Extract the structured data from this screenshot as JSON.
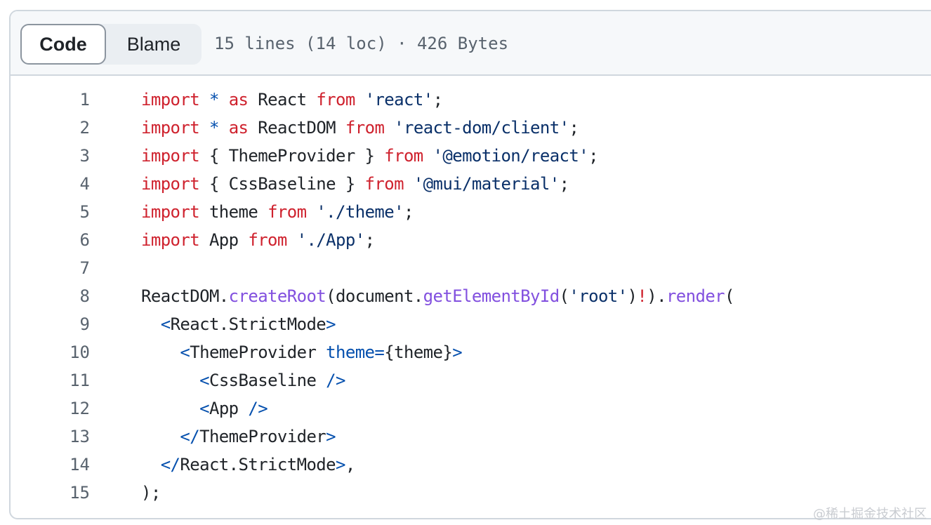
{
  "tabs": [
    {
      "label": "Code",
      "active": true
    },
    {
      "label": "Blame",
      "active": false
    }
  ],
  "file_info": "15 lines (14 loc) · 426 Bytes",
  "code_lines": [
    {
      "number": "1",
      "tokens": [
        {
          "t": "import",
          "k": "kw"
        },
        {
          "t": " ",
          "k": "plain"
        },
        {
          "t": "*",
          "k": "tag"
        },
        {
          "t": " ",
          "k": "plain"
        },
        {
          "t": "as",
          "k": "kw"
        },
        {
          "t": " React ",
          "k": "plain"
        },
        {
          "t": "from",
          "k": "kw"
        },
        {
          "t": " ",
          "k": "plain"
        },
        {
          "t": "'react'",
          "k": "str"
        },
        {
          "t": ";",
          "k": "plain"
        }
      ]
    },
    {
      "number": "2",
      "tokens": [
        {
          "t": "import",
          "k": "kw"
        },
        {
          "t": " ",
          "k": "plain"
        },
        {
          "t": "*",
          "k": "tag"
        },
        {
          "t": " ",
          "k": "plain"
        },
        {
          "t": "as",
          "k": "kw"
        },
        {
          "t": " ReactDOM ",
          "k": "plain"
        },
        {
          "t": "from",
          "k": "kw"
        },
        {
          "t": " ",
          "k": "plain"
        },
        {
          "t": "'react-dom/client'",
          "k": "str"
        },
        {
          "t": ";",
          "k": "plain"
        }
      ]
    },
    {
      "number": "3",
      "tokens": [
        {
          "t": "import",
          "k": "kw"
        },
        {
          "t": " { ThemeProvider } ",
          "k": "plain"
        },
        {
          "t": "from",
          "k": "kw"
        },
        {
          "t": " ",
          "k": "plain"
        },
        {
          "t": "'@emotion/react'",
          "k": "str"
        },
        {
          "t": ";",
          "k": "plain"
        }
      ]
    },
    {
      "number": "4",
      "tokens": [
        {
          "t": "import",
          "k": "kw"
        },
        {
          "t": " { CssBaseline } ",
          "k": "plain"
        },
        {
          "t": "from",
          "k": "kw"
        },
        {
          "t": " ",
          "k": "plain"
        },
        {
          "t": "'@mui/material'",
          "k": "str"
        },
        {
          "t": ";",
          "k": "plain"
        }
      ]
    },
    {
      "number": "5",
      "tokens": [
        {
          "t": "import",
          "k": "kw"
        },
        {
          "t": " theme ",
          "k": "plain"
        },
        {
          "t": "from",
          "k": "kw"
        },
        {
          "t": " ",
          "k": "plain"
        },
        {
          "t": "'./theme'",
          "k": "str"
        },
        {
          "t": ";",
          "k": "plain"
        }
      ]
    },
    {
      "number": "6",
      "tokens": [
        {
          "t": "import",
          "k": "kw"
        },
        {
          "t": " App ",
          "k": "plain"
        },
        {
          "t": "from",
          "k": "kw"
        },
        {
          "t": " ",
          "k": "plain"
        },
        {
          "t": "'./App'",
          "k": "str"
        },
        {
          "t": ";",
          "k": "plain"
        }
      ]
    },
    {
      "number": "7",
      "tokens": []
    },
    {
      "number": "8",
      "tokens": [
        {
          "t": "ReactDOM.",
          "k": "plain"
        },
        {
          "t": "createRoot",
          "k": "fn"
        },
        {
          "t": "(document.",
          "k": "plain"
        },
        {
          "t": "getElementById",
          "k": "fn"
        },
        {
          "t": "(",
          "k": "plain"
        },
        {
          "t": "'root'",
          "k": "str"
        },
        {
          "t": ")",
          "k": "plain"
        },
        {
          "t": "!",
          "k": "kw"
        },
        {
          "t": ").",
          "k": "plain"
        },
        {
          "t": "render",
          "k": "fn"
        },
        {
          "t": "(",
          "k": "plain"
        }
      ]
    },
    {
      "number": "9",
      "tokens": [
        {
          "t": "  ",
          "k": "plain"
        },
        {
          "t": "<",
          "k": "tag"
        },
        {
          "t": "React.StrictMode",
          "k": "plain"
        },
        {
          "t": ">",
          "k": "tag"
        }
      ]
    },
    {
      "number": "10",
      "tokens": [
        {
          "t": "    ",
          "k": "plain"
        },
        {
          "t": "<",
          "k": "tag"
        },
        {
          "t": "ThemeProvider ",
          "k": "plain"
        },
        {
          "t": "theme",
          "k": "attr"
        },
        {
          "t": "=",
          "k": "tag"
        },
        {
          "t": "{theme}",
          "k": "plain"
        },
        {
          "t": ">",
          "k": "tag"
        }
      ]
    },
    {
      "number": "11",
      "tokens": [
        {
          "t": "      ",
          "k": "plain"
        },
        {
          "t": "<",
          "k": "tag"
        },
        {
          "t": "CssBaseline ",
          "k": "plain"
        },
        {
          "t": "/>",
          "k": "tag"
        }
      ]
    },
    {
      "number": "12",
      "tokens": [
        {
          "t": "      ",
          "k": "plain"
        },
        {
          "t": "<",
          "k": "tag"
        },
        {
          "t": "App ",
          "k": "plain"
        },
        {
          "t": "/>",
          "k": "tag"
        }
      ]
    },
    {
      "number": "13",
      "tokens": [
        {
          "t": "    ",
          "k": "plain"
        },
        {
          "t": "</",
          "k": "tag"
        },
        {
          "t": "ThemeProvider",
          "k": "plain"
        },
        {
          "t": ">",
          "k": "tag"
        }
      ]
    },
    {
      "number": "14",
      "tokens": [
        {
          "t": "  ",
          "k": "plain"
        },
        {
          "t": "</",
          "k": "tag"
        },
        {
          "t": "React.StrictMode",
          "k": "plain"
        },
        {
          "t": ">",
          "k": "tag"
        },
        {
          "t": ",",
          "k": "plain"
        }
      ]
    },
    {
      "number": "15",
      "tokens": [
        {
          "t": ");",
          "k": "plain"
        }
      ]
    }
  ],
  "watermark": "@稀土掘金技术社区",
  "colors": {
    "keyword": "#cf222e",
    "string": "#0a3069",
    "function": "#8250df",
    "tag": "#0550ae",
    "text": "#1f2328",
    "line_number": "#59636e"
  }
}
